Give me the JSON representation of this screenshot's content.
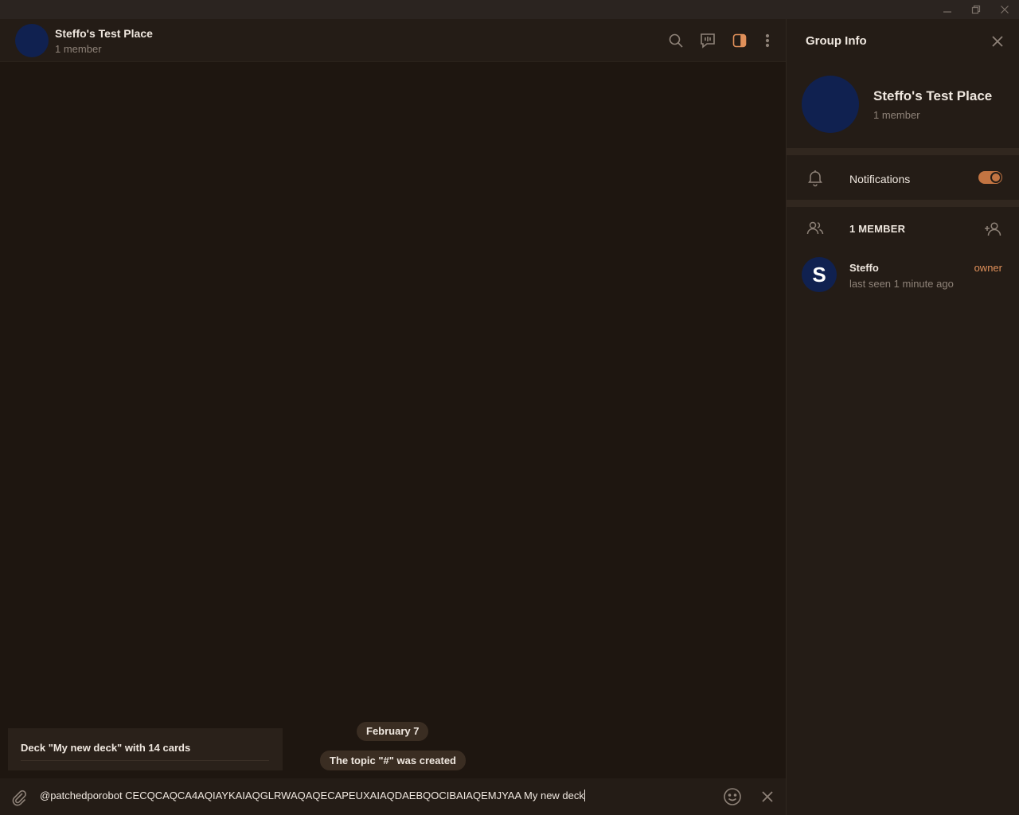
{
  "window": {
    "minimize_icon": "minimize-icon",
    "maximize_icon": "restore-icon",
    "close_icon": "close-icon"
  },
  "chat": {
    "title": "Steffo's Test Place",
    "subtitle": "1 member",
    "header_icons": [
      "search-icon",
      "topics-icon",
      "sidebar-toggle-icon",
      "more-icon"
    ],
    "date_pill": "February 7",
    "service_message": "The topic \"#\" was created",
    "inline_result": "Deck \"My new deck\" with 14 cards",
    "composer_text": "@patchedporobot CECQCAQCA4AQIAYKAIAQGLRWAQAQECAPEUXAIAQDAEBQOCIBAIAQEMJYAA My new deck"
  },
  "panel": {
    "title": "Group Info",
    "group_name": "Steffo's Test Place",
    "group_subtitle": "1 member",
    "notifications_label": "Notifications",
    "notifications_enabled": true,
    "members_header": "1 MEMBER",
    "members": [
      {
        "initial": "S",
        "name": "Steffo",
        "status": "last seen 1 minute ago",
        "role": "owner"
      }
    ]
  },
  "colors": {
    "background": "#1e1610",
    "header": "#241c16",
    "accent": "#e0905a",
    "avatar": "#102150"
  }
}
